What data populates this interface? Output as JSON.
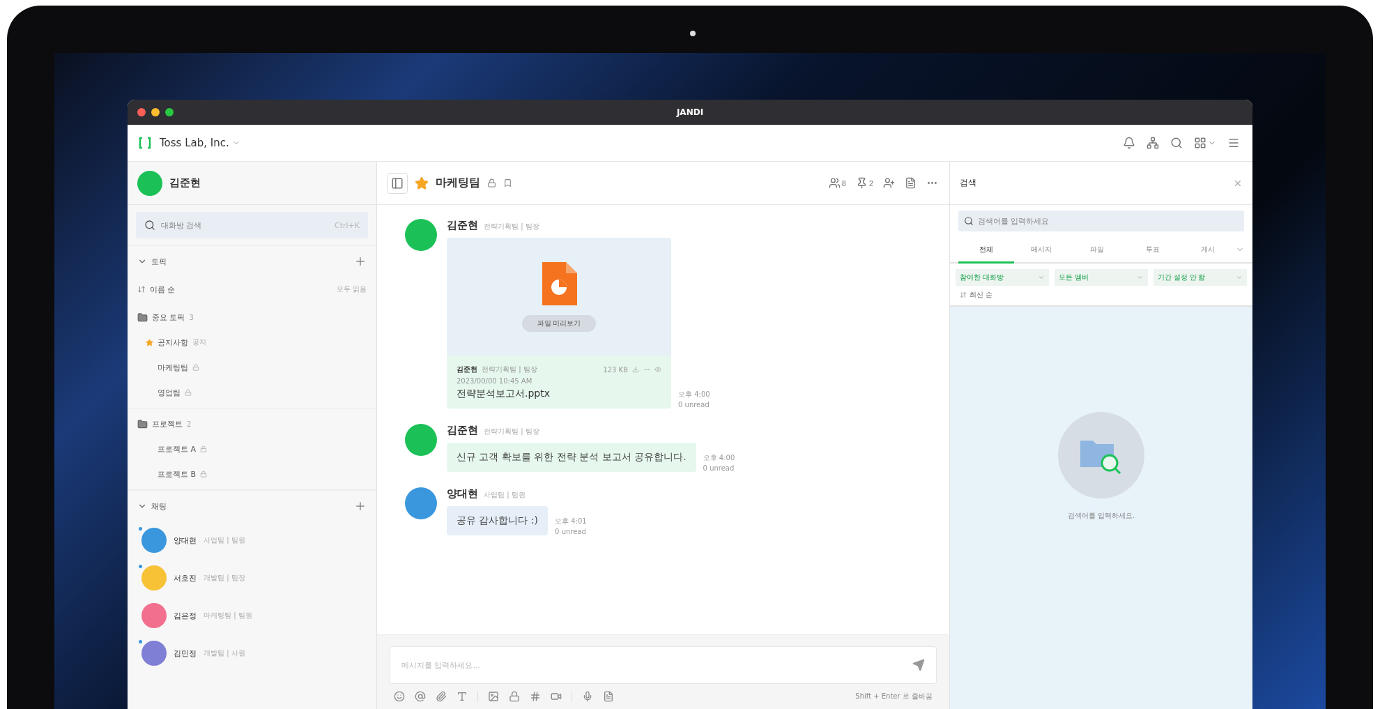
{
  "window": {
    "title": "JANDI"
  },
  "topbar": {
    "team": "Toss Lab, Inc."
  },
  "sidebar": {
    "profile": {
      "name": "김준현",
      "color": "#1bc157"
    },
    "search": {
      "placeholder": "대화방 검색",
      "shortcut": "Ctrl+K"
    },
    "topics": {
      "label": "토픽",
      "expanded": true,
      "sort": "이름 순",
      "action": "모두 읽음",
      "folders": [
        {
          "name": "중요 토픽",
          "count": "3",
          "children": [
            {
              "name": "공지사항",
              "starred": true,
              "badge": "공지"
            },
            {
              "name": "마케팅팀",
              "starred": false
            },
            {
              "name": "영업팀",
              "starred": false
            }
          ]
        },
        {
          "name": "프로젝트",
          "count": "2",
          "children": [
            {
              "name": "프로젝트 A",
              "starred": false
            },
            {
              "name": "프로젝트 B",
              "starred": false
            }
          ]
        }
      ]
    },
    "chats": {
      "label": "채팅",
      "expanded": true,
      "items": [
        {
          "name": "양대현",
          "meta": "사업팀 | 팀원",
          "color": "#3a97de",
          "unread": true
        },
        {
          "name": "서호진",
          "meta": "개발팀 | 팀장",
          "color": "#f7c236",
          "unread": true
        },
        {
          "name": "김은정",
          "meta": "마케팅팀 | 팀원",
          "color": "#f26f8e",
          "unread": false
        },
        {
          "name": "김민정",
          "meta": "개발팀 | 사원",
          "color": "#7f7fd5",
          "unread": true
        }
      ]
    }
  },
  "channel": {
    "name": "마케팅팀",
    "starred": true,
    "members": "8",
    "pins": "2",
    "messages": [
      {
        "kind": "file",
        "author": {
          "name": "김준현",
          "meta": "전략기획팀 | 팀장",
          "color": "#1bc157"
        },
        "preview": "파일 미리보기",
        "file_author": "김준현",
        "file_meta": "전략기획팀 | 팀장",
        "size": "123 KB",
        "date": "2023/00/00 10:45 AM",
        "file_name": "전략분석보고서.pptx",
        "time": "오후 4:00",
        "read": "0 unread"
      },
      {
        "kind": "text",
        "author": {
          "name": "김준현",
          "meta": "전략기획팀 | 팀장",
          "color": "#1bc157"
        },
        "text": "신규 고객 확보를 위한 전략 분석 보고서 공유합니다.",
        "color": "#e6f8ee",
        "time": "오후 4:00",
        "read": "0 unread"
      },
      {
        "kind": "text",
        "author": {
          "name": "양대현",
          "meta": "사업팀 | 팀원",
          "color": "#3a97de"
        },
        "text": "공유 감사합니다 :)",
        "color": "#e6eff8",
        "time": "오후 4:01",
        "read": "0 unread"
      }
    ],
    "composer": {
      "placeholder": "메시지를 입력하세요...",
      "hint": "Shift + Enter 로 줄바꿈"
    }
  },
  "search_panel": {
    "title": "검색",
    "placeholder": "검색어를 입력하세요",
    "tabs": [
      {
        "label": "전체",
        "selected": true
      },
      {
        "label": "메시지",
        "selected": false
      },
      {
        "label": "파일",
        "selected": false
      },
      {
        "label": "투표",
        "selected": false
      },
      {
        "label": "게시",
        "selected": false
      }
    ],
    "filters": [
      "참여한 대화방",
      "모든 멤버",
      "기간 설정 안 함"
    ],
    "sort": "최신 순",
    "empty": "검색어를 입력하세요."
  }
}
